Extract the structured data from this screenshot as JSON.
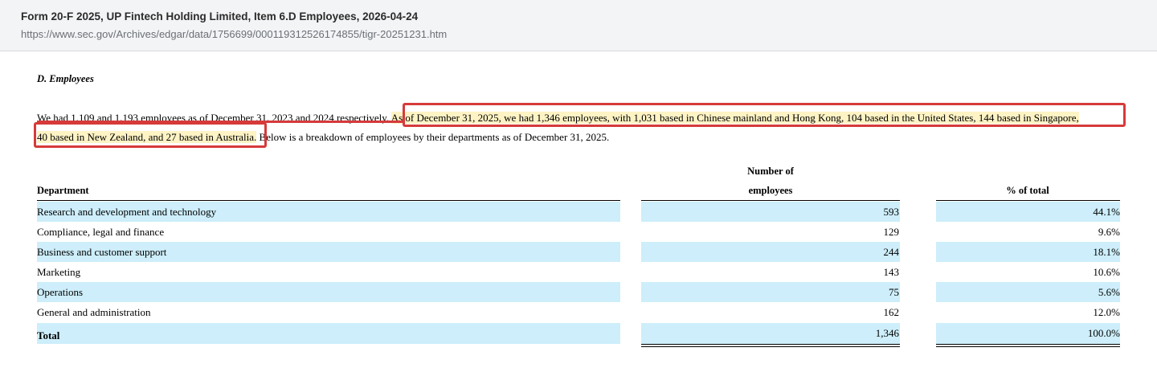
{
  "header": {
    "title": "Form 20-F 2025, UP Fintech Holding Limited, Item 6.D Employees, 2026-04-24",
    "url": "https://www.sec.gov/Archives/edgar/data/1756699/000119312526174855/tigr-20251231.htm"
  },
  "document": {
    "section_heading": "D. Employees",
    "paragraph": {
      "before": "We had 1,109 and 1,193 employees as of December 31, 2023 and 2024 respectively. ",
      "highlighted_line1": "As of December 31, 2025, we had 1,346 employees, with 1,031 based in Chinese mainland and Hong Kong, 104 based in the United States, 144 based in Singapore,",
      "highlighted_line2": "40 based in New Zealand, and 27 based in Australia.",
      "after": " Below is a breakdown of employees by their departments as of December 31, 2025."
    },
    "colors": {
      "highlight": "#fdf3c4",
      "annotation_box": "#d63a3a",
      "row_shade": "#cdeefa"
    },
    "table": {
      "headers": {
        "department": "Department",
        "count_line1": "Number of",
        "count_line2": "employees",
        "percent": "% of total"
      },
      "rows": [
        {
          "department": "Research and development and technology",
          "count": "593",
          "percent": "44.1%"
        },
        {
          "department": "Compliance, legal and finance",
          "count": "129",
          "percent": "9.6%"
        },
        {
          "department": "Business and customer support",
          "count": "244",
          "percent": "18.1%"
        },
        {
          "department": "Marketing",
          "count": "143",
          "percent": "10.6%"
        },
        {
          "department": "Operations",
          "count": "75",
          "percent": "5.6%"
        },
        {
          "department": "General and administration",
          "count": "162",
          "percent": "12.0%"
        }
      ],
      "total": {
        "label": "Total",
        "count": "1,346",
        "percent": "100.0%"
      }
    }
  }
}
